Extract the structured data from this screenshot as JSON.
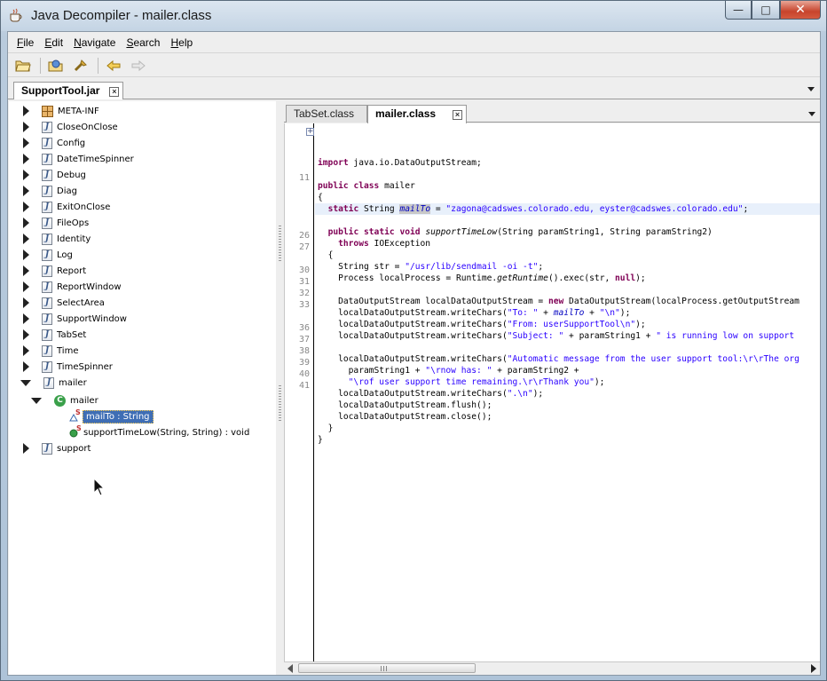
{
  "window": {
    "title": "Java Decompiler - mailer.class",
    "close_glyph": "✕",
    "maximize_glyph": "□",
    "minimize_glyph": "—"
  },
  "menu": [
    {
      "key": "F",
      "rest": "ile"
    },
    {
      "key": "E",
      "rest": "dit"
    },
    {
      "key": "N",
      "rest": "avigate"
    },
    {
      "key": "S",
      "rest": "earch"
    },
    {
      "key": "H",
      "rest": "elp"
    }
  ],
  "toolbar": {
    "icons": [
      "open-file-icon",
      "open-type-icon",
      "search-icon",
      "back-icon",
      "forward-icon"
    ]
  },
  "jar_tab": {
    "label": "SupportTool.jar",
    "close_glyph": "×"
  },
  "tree": {
    "items": [
      {
        "label": "META-INF",
        "type": "package",
        "expanded": false
      },
      {
        "label": "CloseOnClose",
        "type": "file",
        "expanded": false
      },
      {
        "label": "Config",
        "type": "file",
        "expanded": false
      },
      {
        "label": "DateTimeSpinner",
        "type": "file",
        "expanded": false
      },
      {
        "label": "Debug",
        "type": "file",
        "expanded": false
      },
      {
        "label": "Diag",
        "type": "file",
        "expanded": false
      },
      {
        "label": "ExitOnClose",
        "type": "file",
        "expanded": false
      },
      {
        "label": "FileOps",
        "type": "file",
        "expanded": false
      },
      {
        "label": "Identity",
        "type": "file",
        "expanded": false
      },
      {
        "label": "Log",
        "type": "file",
        "expanded": false
      },
      {
        "label": "Report",
        "type": "file",
        "expanded": false
      },
      {
        "label": "ReportWindow",
        "type": "file",
        "expanded": false
      },
      {
        "label": "SelectArea",
        "type": "file",
        "expanded": false
      },
      {
        "label": "SupportWindow",
        "type": "file",
        "expanded": false
      },
      {
        "label": "TabSet",
        "type": "file",
        "expanded": false
      },
      {
        "label": "Time",
        "type": "file",
        "expanded": false
      },
      {
        "label": "TimeSpinner",
        "type": "file",
        "expanded": false
      },
      {
        "label": "mailer",
        "type": "file",
        "expanded": true
      }
    ],
    "class_node": {
      "label": "mailer",
      "badge": "C"
    },
    "field_node": {
      "label": "mailTo : String",
      "modifier": "S"
    },
    "method_node": {
      "label": "supportTimeLow(String, String) : void",
      "modifier": "S"
    },
    "last_item": {
      "label": "support"
    },
    "file_badge": "J"
  },
  "class_tabs": [
    {
      "label": "TabSet.class",
      "active": false
    },
    {
      "label": "mailer.class",
      "active": true,
      "close_glyph": "×"
    }
  ],
  "editor": {
    "fold_glyph": "+",
    "line_numbers": [
      "11",
      "26",
      "27",
      "30",
      "31",
      "32",
      "33",
      "36",
      "37",
      "38",
      "39",
      "40",
      "41"
    ],
    "code": {
      "import_kw": "import",
      "import_rest": " java.io.DataOutputStream;",
      "class_kw1": "public",
      "class_kw2": "class",
      "class_name": " mailer",
      "open_brace": "{",
      "field_kw": "static",
      "field_type": " String ",
      "field_name": "mailTo",
      "field_eq": " = ",
      "field_val": "\"zagona@cadswes.colorado.edu, eyster@cadswes.colorado.edu\"",
      "field_end": ";",
      "method_kw1": "public",
      "method_kw2": "static",
      "method_kw3": "void",
      "method_name": "supportTimeLow",
      "method_params": "(String paramString1, String paramString2)",
      "throws_kw": "throws",
      "throws_rest": " IOException",
      "method_open": "{",
      "l26a": "String str = ",
      "l26b": "\"/usr/lib/sendmail -oi -t\"",
      "l26c": ";",
      "l27a": "Process localProcess = Runtime.",
      "l27b": "getRuntime",
      "l27c": "().exec(str, ",
      "l27d": "null",
      "l27e": ");",
      "l30a": "DataOutputStream localDataOutputStream = ",
      "l30b": "new",
      "l30c": " DataOutputStream(localProcess.getOutputStream",
      "l31a": "localDataOutputStream.writeChars(",
      "l31b": "\"To: \"",
      "l31c": " + ",
      "l31d": "mailTo",
      "l31e": " + ",
      "l31f": "\"\\n\"",
      "l31g": ");",
      "l32a": "localDataOutputStream.writeChars(",
      "l32b": "\"From: userSupportTool\\n\"",
      "l32c": ");",
      "l33a": "localDataOutputStream.writeChars(",
      "l33b": "\"Subject: \"",
      "l33c": " + paramString1 + ",
      "l33d": "\" is running low on support",
      "l36a": "localDataOutputStream.writeChars(",
      "l36b": "\"Automatic message from the user support tool:\\r\\rThe org",
      "l37a": "paramString1 + ",
      "l37b": "\"\\rnow has: \"",
      "l37c": " + paramString2 + ",
      "l38a": "\"\\rof user support time remaining.\\r\\rThank you\"",
      "l38b": ");",
      "l39a": "localDataOutputStream.writeChars(",
      "l39b": "\".\\n\"",
      "l39c": ");",
      "l40": "localDataOutputStream.flush();",
      "l41": "localDataOutputStream.close();",
      "method_close": "}",
      "class_close": "}"
    }
  }
}
